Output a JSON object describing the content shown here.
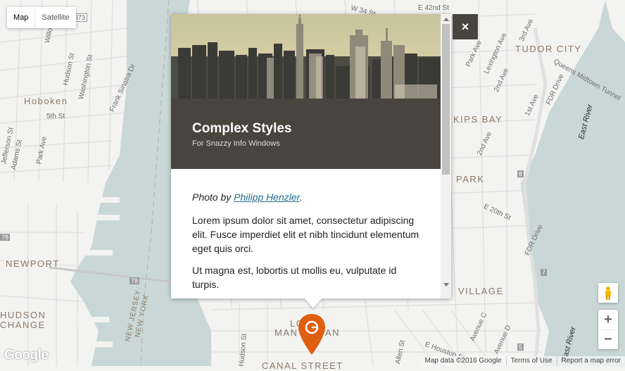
{
  "map": {
    "type_control": {
      "map_label": "Map",
      "satellite_label": "Satellite"
    },
    "area_labels": [
      "Hoboken",
      "TUDOR CITY",
      "KIPS BAY",
      "PARK",
      "NEWPORT",
      "HUDSON",
      "CHANGE",
      "VILLAGE",
      "LO",
      "MAN",
      "AN",
      "CANAL STREET"
    ],
    "street_labels": [
      "Willow Ave",
      "Hudson St",
      "Washington St",
      "Frank Sinatra Dr",
      "5th St",
      "Park Ave",
      "Adams St",
      "Jefferson St",
      "Park Ave",
      "Lexington Ave",
      "3rd Ave",
      "2nd Ave",
      "1st Ave",
      "FDR Drive",
      "Queens Midtown Tunnel",
      "2nd Ave",
      "E 20th St",
      "Avenue C",
      "E Houston St",
      "Allen St",
      "Hudson St",
      "NEW JERSEY",
      "NEW YORK",
      "W 34 St",
      "E 42nd St",
      "FDR Drive",
      "Avenue D"
    ],
    "river_labels": [
      "East River",
      "East River"
    ],
    "route_shields": [
      "673",
      "78",
      "78",
      "8",
      "7",
      "5"
    ]
  },
  "info_window": {
    "title": "Complex Styles",
    "subtitle": "For Snazzy Info Windows",
    "credit_prefix": "Photo by ",
    "credit_link": "Philipp Henzler",
    "credit_suffix": ".",
    "paragraph1": "Lorem ipsum dolor sit amet, consectetur adipiscing elit. Fusce imperdiet elit et nibh tincidunt elementum eget quis orci.",
    "paragraph2": "Ut magna est, lobortis ut mollis eu, vulputate id turpis."
  },
  "close_button": {
    "label": "×"
  },
  "zoom": {
    "in_label": "+",
    "out_label": "−"
  },
  "footer": {
    "map_data": "Map data ©2016 Google",
    "terms": "Terms of Use",
    "report": "Report a map error"
  },
  "logo": {
    "text": "Google"
  },
  "colors": {
    "header_bg": "#48453f",
    "marker": "#e05e0f",
    "water": "#c9d8d6",
    "land": "#f3f3f1",
    "link": "#1f6e8c"
  },
  "icons": [
    "pegman-icon",
    "close-icon",
    "map-marker-icon",
    "zoom-in-icon",
    "zoom-out-icon"
  ]
}
